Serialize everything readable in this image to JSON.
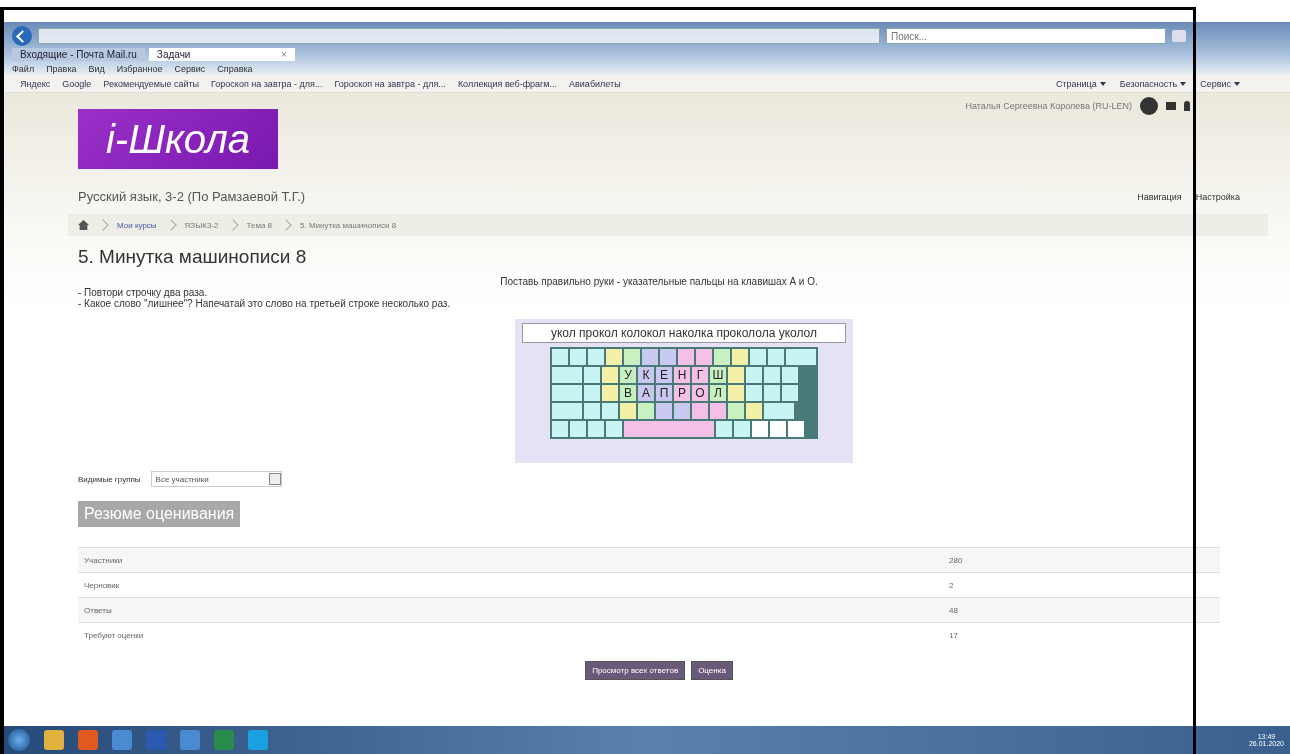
{
  "browser": {
    "search": {
      "placeholder": "Поиск..."
    },
    "tabs": [
      {
        "label": "Входящие - Почта Mail.ru",
        "selected": false
      },
      {
        "label": "Задачи",
        "selected": true,
        "close": "×"
      }
    ],
    "menu": [
      "Файл",
      "Правка",
      "Вид",
      "Избранное",
      "Сервис",
      "Справка"
    ],
    "favorites": [
      "Яндекс",
      "Google",
      "Рекомендуемые сайты",
      "Гороскоп на завтра - для...",
      "Гороскоп на завтра - для...",
      "Коллекция веб-фрагм...",
      "Авиабилеты"
    ],
    "commands": [
      "Страница",
      "Безопасность",
      "Сервис"
    ]
  },
  "site": {
    "logo": "i-Школа",
    "user": "Наталья Сергеевна Королева (RU-LEN)",
    "course": "Русский язык, 3-2 (По Рамзаевой Т.Г.)",
    "nav": [
      "Навигация",
      "Настройка"
    ],
    "breadcrumb": [
      {
        "label": "Мои курсы",
        "kind": "link"
      },
      {
        "label": "ЯЗЫК3-2",
        "kind": "plain"
      },
      {
        "label": "Тема 8",
        "kind": "plain"
      },
      {
        "label": "5. Минутка машинописи 8",
        "kind": "plain"
      }
    ]
  },
  "assignment": {
    "title": "5. Минутка машинописи 8",
    "intro": "Поставь правильно руки - указательные пальцы на клавишах А и О.",
    "steps": [
      "- Повтори строчку два раза.",
      "- Какое слово \"лишнее\"? Напечатай это слово на третьей строке несколько раз."
    ],
    "exercise": {
      "line": "укол прокол колокол наколка проколола уколол",
      "rows": [
        [
          {
            "color": "#c8f4f4"
          },
          {
            "color": "#c8f4f4"
          },
          {
            "color": "#c8f4f4"
          },
          {
            "color": "#f4f0a8"
          },
          {
            "color": "#c8f0c0"
          },
          {
            "color": "#c8c8f0"
          },
          {
            "color": "#c8c8f0"
          },
          {
            "color": "#f4c0e8"
          },
          {
            "color": "#f4c0e8"
          },
          {
            "color": "#c8f0c0"
          },
          {
            "color": "#f4f0a8"
          },
          {
            "color": "#c8f4f4"
          },
          {
            "color": "#c8f4f4"
          },
          {
            "color": "#c8f4f4",
            "kind": "wide"
          }
        ],
        [
          {
            "color": "#c8f4f4",
            "kind": "wide"
          },
          {
            "color": "#c8f4f4"
          },
          {
            "color": "#f4f0a8"
          },
          {
            "color": "#c8f0c0",
            "label": "У"
          },
          {
            "color": "#c8c8f0",
            "label": "К"
          },
          {
            "color": "#c8c8f0",
            "label": "Е"
          },
          {
            "color": "#f4c0e8",
            "label": "Н"
          },
          {
            "color": "#f4c0e8",
            "label": "Г"
          },
          {
            "color": "#c8f0c0",
            "label": "Ш"
          },
          {
            "color": "#f4f0a8"
          },
          {
            "color": "#c8f4f4"
          },
          {
            "color": "#c8f4f4"
          },
          {
            "color": "#c8f4f4"
          }
        ],
        [
          {
            "color": "#c8f4f4",
            "kind": "wide"
          },
          {
            "color": "#c8f4f4"
          },
          {
            "color": "#f4f0a8"
          },
          {
            "color": "#c8f0c0",
            "label": "В"
          },
          {
            "color": "#c8c8f0",
            "label": "А"
          },
          {
            "color": "#c8c8f0",
            "label": "П"
          },
          {
            "color": "#f4c0e8",
            "label": "Р"
          },
          {
            "color": "#f4c0e8",
            "label": "О"
          },
          {
            "color": "#c8f0c0",
            "label": "Л"
          },
          {
            "color": "#f4f0a8"
          },
          {
            "color": "#c8f4f4"
          },
          {
            "color": "#c8f4f4"
          },
          {
            "color": "#c8f4f4"
          }
        ],
        [
          {
            "color": "#c8f4f4",
            "kind": "wide"
          },
          {
            "color": "#c8f4f4"
          },
          {
            "color": "#c8f4f4"
          },
          {
            "color": "#f4f0a8"
          },
          {
            "color": "#c8f0c0"
          },
          {
            "color": "#c8c8f0"
          },
          {
            "color": "#c8c8f0"
          },
          {
            "color": "#f4c0e8"
          },
          {
            "color": "#f4c0e8"
          },
          {
            "color": "#c8f0c0"
          },
          {
            "color": "#f4f0a8"
          },
          {
            "color": "#c8f4f4",
            "kind": "wide"
          }
        ],
        [
          {
            "color": "#c8f4f4"
          },
          {
            "color": "#c8f4f4"
          },
          {
            "color": "#c8f4f4"
          },
          {
            "color": "#c8f4f4"
          },
          {
            "color": "#f4c0e8",
            "kind": "space"
          },
          {
            "color": "#c8f4f4"
          },
          {
            "color": "#c8f4f4"
          },
          {
            "color": "#ffffff"
          },
          {
            "color": "#ffffff"
          },
          {
            "color": "#ffffff"
          }
        ]
      ]
    }
  },
  "groups": {
    "label": "Видимые группы",
    "value": "Все участники"
  },
  "summary": {
    "heading": "Резюме оценивания",
    "rows": [
      {
        "label": "Участники",
        "value": "280"
      },
      {
        "label": "Черновик",
        "value": "2"
      },
      {
        "label": "Ответы",
        "value": "48"
      },
      {
        "label": "Требуют оценки",
        "value": "17"
      }
    ]
  },
  "buttons": [
    "Просмотр всех ответов",
    "Оценка"
  ],
  "taskbar": {
    "time": "13:49",
    "date": "26.01.2020"
  }
}
